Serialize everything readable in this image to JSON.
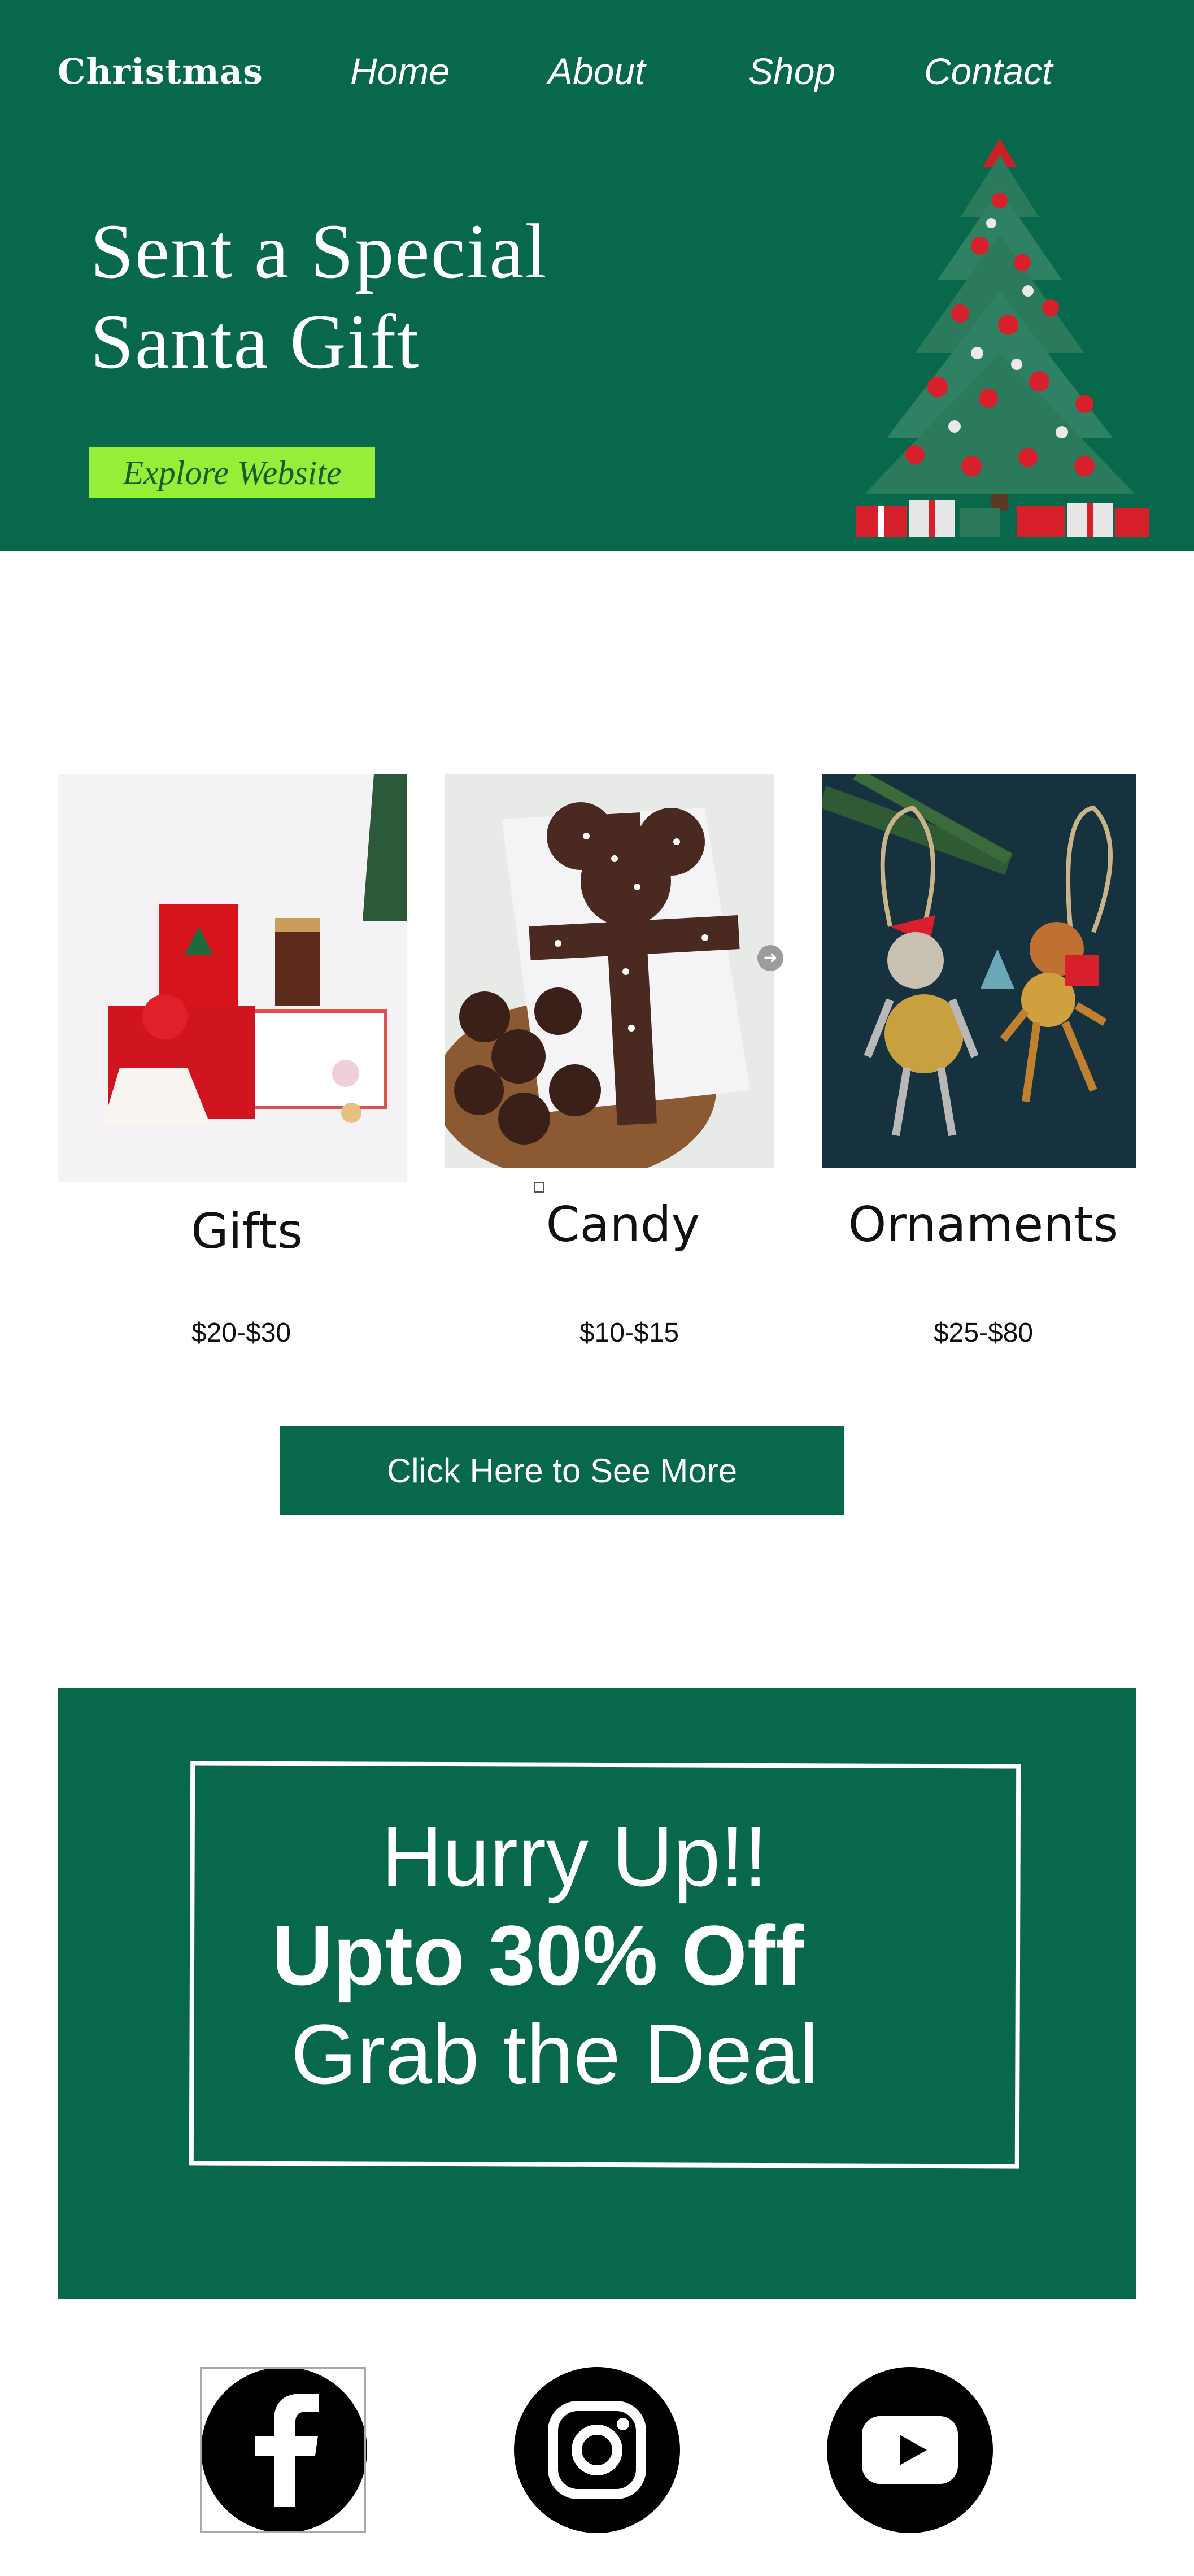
{
  "header": {
    "brand": "Christmas",
    "nav": [
      {
        "label": "Home"
      },
      {
        "label": "About"
      },
      {
        "label": "Shop"
      },
      {
        "label": "Contact"
      }
    ]
  },
  "hero": {
    "title_line1": "Sent a Special",
    "title_line2": "Santa Gift",
    "cta_label": "Explore Website"
  },
  "products": [
    {
      "name": "Gifts",
      "price": "$20-$30"
    },
    {
      "name": "Candy",
      "price": "$10-$15"
    },
    {
      "name": "Ornaments",
      "price": "$25-$80"
    }
  ],
  "see_more_label": "Click Here  to See More",
  "promo": {
    "line1": "Hurry Up!!",
    "line2": "Upto 30% Off",
    "line3": "Grab the  Deal"
  },
  "social": [
    {
      "icon": "facebook-icon"
    },
    {
      "icon": "instagram-icon"
    },
    {
      "icon": "youtube-icon"
    }
  ],
  "colors": {
    "primary_green": "#08684c",
    "cta_lime": "#95ef38",
    "white": "#ffffff",
    "black": "#000000"
  }
}
